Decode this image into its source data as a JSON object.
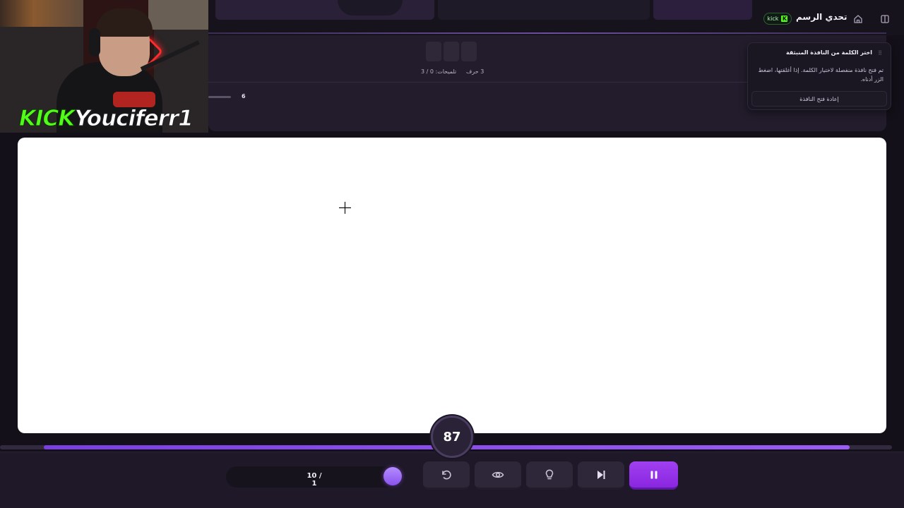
{
  "header": {
    "title": "تحدي الرسم",
    "kick_badge": "kick",
    "kick_badge_letter": "K"
  },
  "webcam": {
    "platform_logo": "KICK",
    "username": "Youciferr1"
  },
  "game_panel": {
    "letter_count": "3 حرف",
    "hints": "تلميحات: 0 / 3",
    "slider_value": "6"
  },
  "popup": {
    "title": "اختر الكلمة من النافذة المنبثقة",
    "message": "تم فتح نافذة منفصلة لاختيار الكلمة. إذا أغلقتها، اضغط الزر أدناه.",
    "button_label": "إعادة فتح النافذة"
  },
  "timer": {
    "value": "87"
  },
  "progress": {
    "fraction": 0.95
  },
  "round": {
    "text": "10 / 1"
  },
  "controls": {
    "reset_icon": "rotate-ccw-icon",
    "reveal_icon": "eye-icon",
    "hint_icon": "lightbulb-icon",
    "skip_icon": "skip-forward-icon",
    "pause_icon": "pause-icon"
  },
  "colors": {
    "accent": "#8a26e0",
    "progress": "#9b5cf5",
    "kick_green": "#53fc18",
    "background": "#141019"
  }
}
